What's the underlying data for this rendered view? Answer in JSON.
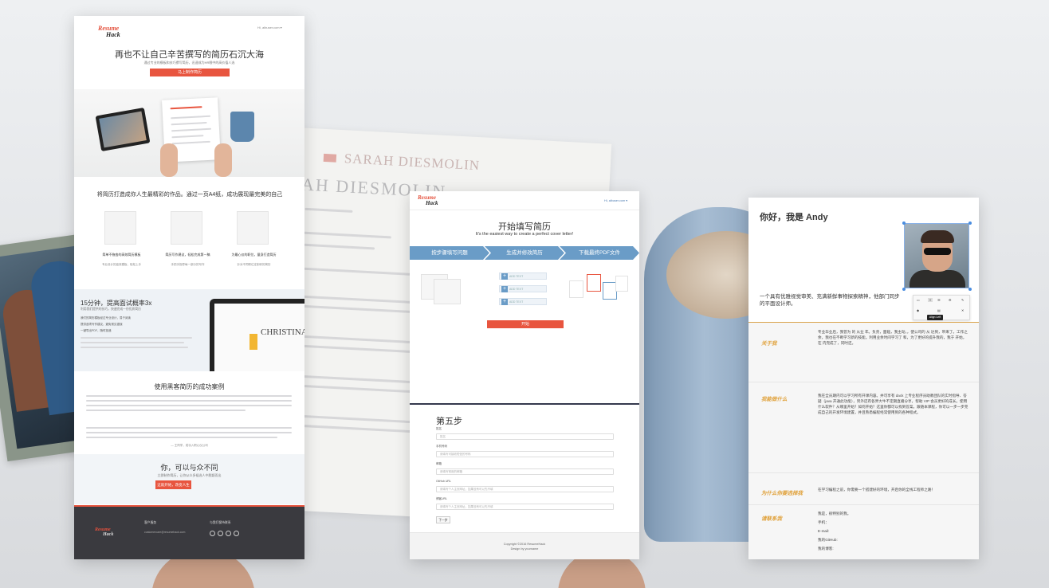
{
  "background": {
    "paper_header": "SARAH DIESMOLIN",
    "paper_name": "AH DIESMOLIN"
  },
  "landing": {
    "logo_line1": "Resume",
    "logo_line2": "Hack",
    "user_menu": "Hi, albuser.com ▾",
    "hero_title": "再也不让自己辛苦撰写的简历石沉大海",
    "hero_subtitle": "通过专业的模板和技巧撰写简历，迅速成为HR眼中的高价值人选",
    "hero_button": "马上制作简历",
    "section2_title": "将简历打造成你人生最精彩的作品。通过一页A4纸，成功展现最完美的自己",
    "features": [
      {
        "title": "简单不拖沓的高效简历模板",
        "desc": "专业设计的高效模板，轻松上手"
      },
      {
        "title": "简历写作建议，轻松完成第一稿",
        "desc": "手把手指导每一部分的写作"
      },
      {
        "title": "为最心仪的职位，量身打造简历",
        "desc": "针对不同职位定制你的简历"
      }
    ],
    "section3_title": "15分钟，提高面试概率3x",
    "section3_subtitle": "利用我们提供的技巧，快速完成一份优质简历",
    "section3_bullets": [
      "我们的简历模板经过专业设计，易于阅读",
      "提供逐项写作建议，避免常见错误",
      "一键导出PDF，随时投递"
    ],
    "laptop_name": "CHRISTINA",
    "section4_title": "使用黑客简历的成功案例",
    "section4_quote": "— 王同学，成功入职心仪公司",
    "section5_title": "你，可以与众不同",
    "section5_subtitle": "立即制作简历，让你从众多候选人中脱颖而出",
    "section5_button": "这就开始，改变人生",
    "footer_logo1": "Resume",
    "footer_logo2": "Hack",
    "footer_contact_title": "客户服务",
    "footer_contact_email": "customercare@resumehack.com",
    "footer_social_title": "与我们保持联系"
  },
  "builder": {
    "logo_line1": "Resume",
    "logo_line2": "Hack",
    "user_menu": "Hi, albuser.com ▾",
    "title": "开始填写简历",
    "subtitle": "It's the easiest way to create a perfect cover letter!",
    "steps": [
      "按步骤填写问题",
      "生成并修改简历",
      "下载最终PDF文件"
    ],
    "add_text_rows": [
      "ADD TEXT",
      "ADD TEXT",
      "ADD TEXT"
    ],
    "start_button": "开始",
    "step5_title": "第五步",
    "fields": [
      {
        "label": "姓名",
        "placeholder": "姓名"
      },
      {
        "label": "手机号码",
        "placeholder": "请填写可接收短信的号码"
      },
      {
        "label": "邮箱",
        "placeholder": "请填写常用的邮箱"
      },
      {
        "label": "GitHub URL",
        "placeholder": "请填写个人主页网址，如果没有可以先不填"
      },
      {
        "label": "博客URL",
        "placeholder": "请填写个人主页网址，如果没有可以先不填"
      }
    ],
    "next_button": "下一步",
    "footer_line1": "Copyright ©2016 ResumeHack",
    "footer_line2": "Design by yourname"
  },
  "resume": {
    "greeting": "你好，我是 Andy",
    "tagline": "一个具有优雅视觉审美、充满新鲜事物探索精神，他部门同步 的平面设计师。",
    "tooltip": "Align Left",
    "rows": [
      {
        "label": "关于我",
        "text": "专业毕业后，我曾为 的 从业 年。负责，面临，我主动，，使公司的 从 达到，带来了。工作之余，我也在不断学习新的技能。利用业余时间学习了 和，为了更好的提升我的，我于 开始，在 内完成了，同时还。"
      },
      {
        "label": "我能做什么",
        "text": "我在全员期内可以学习所有开课内容。并可享有 dack 上专业程序员助教团队的实时指导、答疑（java 开通此功能），另外还有各界大牛不定期直播分享，帮助 VIP 会员更好的成长。使用什么软件？从哪里开始？如何开始？这里你都可以找到答案。跟随本课程，你可以一步一步完成自己的开发环境建置，并且熟悉编程经常使用到的各种程式。"
      },
      {
        "label": "为什么你要选择我",
        "text": "在学习编程之前，你需要一个搭建好的环境，开启你的全栈工程师之路！"
      },
      {
        "label": "请联系我",
        "contact": [
          "我是，很特别的我。",
          "手机：",
          "E-mail:",
          "我的GitHub:",
          "我的博客:"
        ]
      }
    ]
  }
}
